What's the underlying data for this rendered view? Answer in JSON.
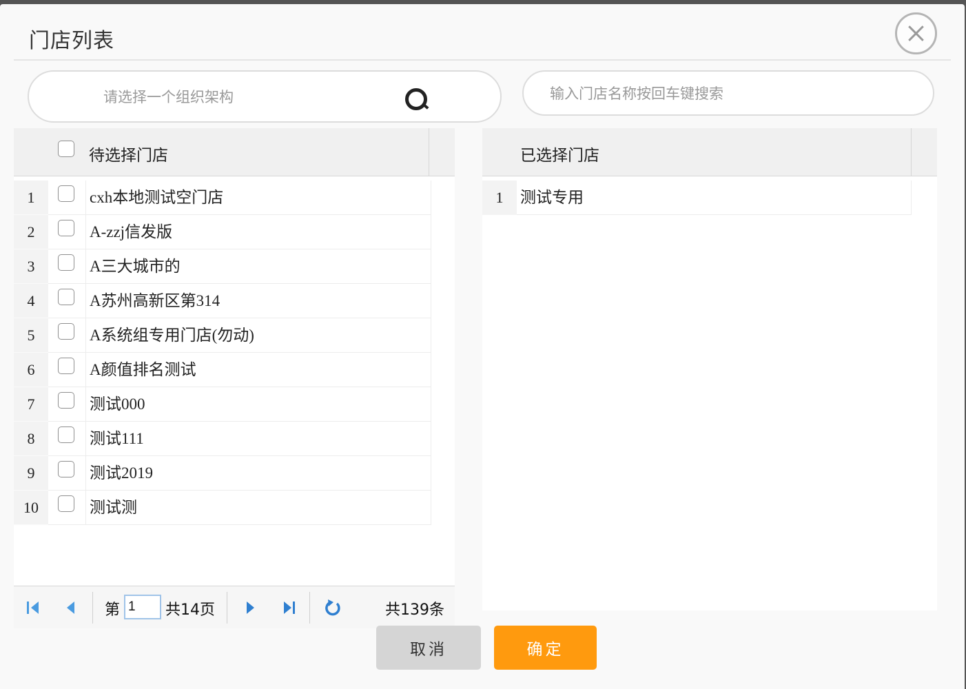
{
  "dialog": {
    "title": "门店列表",
    "close_icon": "close-circle-icon"
  },
  "org_search": {
    "placeholder": "请选择一个组织架构",
    "icon": "search-icon"
  },
  "store_search": {
    "placeholder": "输入门店名称按回车键搜索"
  },
  "left_grid": {
    "header_label": "待选择门店",
    "select_all_checked": false,
    "rows": [
      {
        "num": "1",
        "name": "cxh本地测试空门店",
        "checked": false
      },
      {
        "num": "2",
        "name": "A-zzj信发版",
        "checked": false
      },
      {
        "num": "3",
        "name": "A三大城市的",
        "checked": false
      },
      {
        "num": "4",
        "name": "A苏州高新区第314",
        "checked": false
      },
      {
        "num": "5",
        "name": "A系统组专用门店(勿动)",
        "checked": false
      },
      {
        "num": "6",
        "name": "A颜值排名测试",
        "checked": false
      },
      {
        "num": "7",
        "name": "测试000",
        "checked": false
      },
      {
        "num": "8",
        "name": "测试111",
        "checked": false
      },
      {
        "num": "9",
        "name": "测试2019",
        "checked": false
      },
      {
        "num": "10",
        "name": "测试测",
        "checked": false
      }
    ]
  },
  "right_grid": {
    "header_label": "已选择门店",
    "rows": [
      {
        "num": "1",
        "name": "测试专用"
      }
    ]
  },
  "pager": {
    "page_prefix": "第",
    "current_page": "1",
    "total_pages_text": "共14页",
    "total_records_text": "共139条",
    "accent_color": "#3d8fd9",
    "icons": [
      "first-page-icon",
      "prev-page-icon",
      "next-page-icon",
      "last-page-icon",
      "refresh-icon"
    ]
  },
  "buttons": {
    "cancel": "取消",
    "confirm": "确定",
    "confirm_color": "#ff9a0e",
    "cancel_color": "#d5d5d5"
  }
}
